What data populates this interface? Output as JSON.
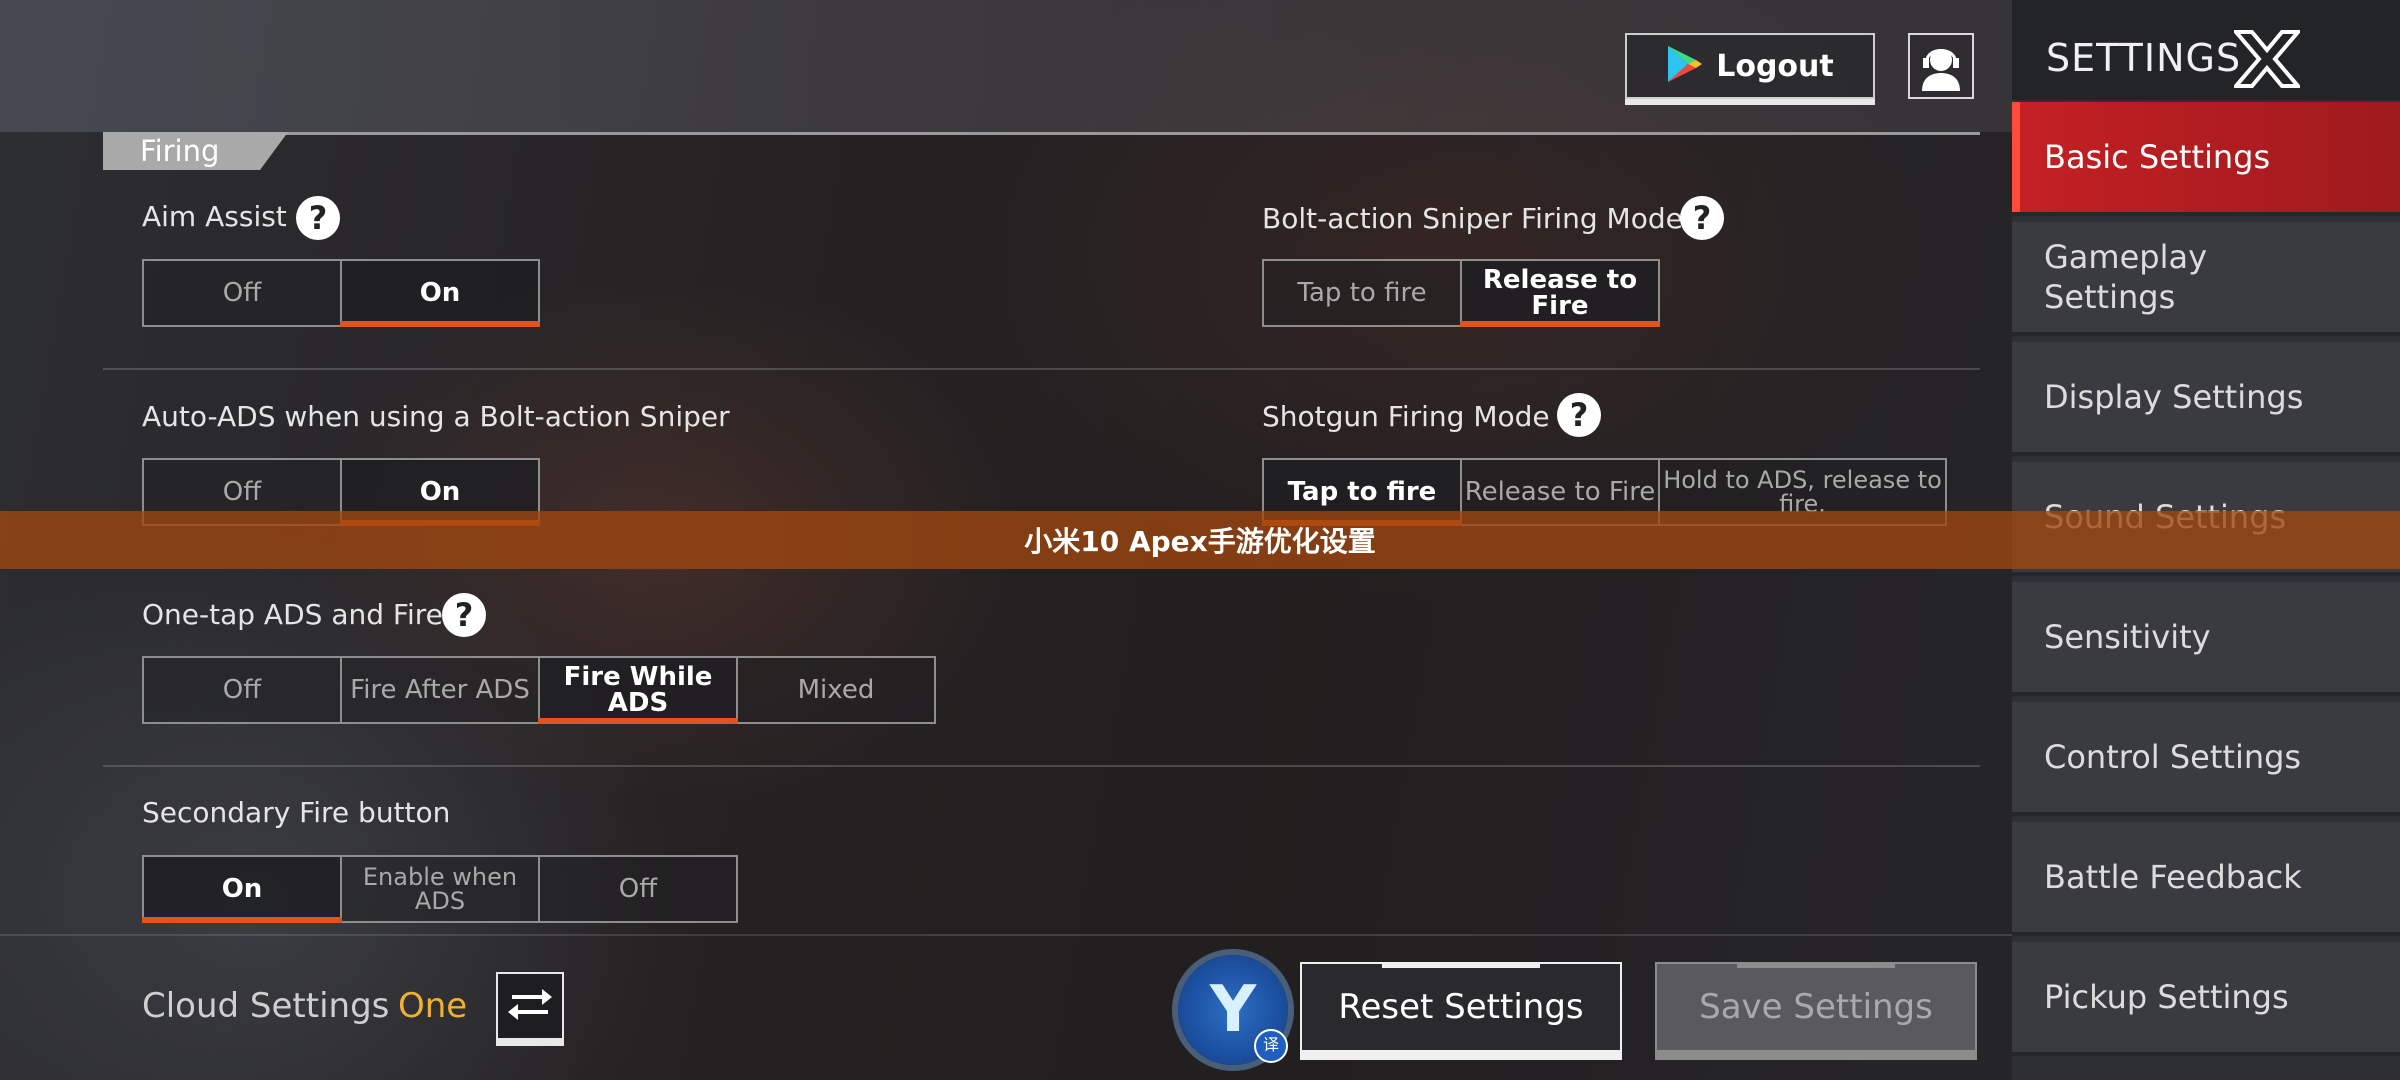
{
  "header": {
    "logout_label": "Logout",
    "support_icon": "headset-support-icon"
  },
  "section": {
    "title": "Firing"
  },
  "settings": {
    "aim_assist": {
      "label": "Aim Assist",
      "options": [
        "Off",
        "On"
      ],
      "selected": "On"
    },
    "bolt_action_mode": {
      "label": "Bolt-action Sniper Firing Mode",
      "options": [
        "Tap to fire",
        "Release to Fire"
      ],
      "selected": "Release to Fire"
    },
    "auto_ads": {
      "label": "Auto-ADS when using a Bolt-action Sniper",
      "options": [
        "Off",
        "On"
      ],
      "selected": "On"
    },
    "shotgun_mode": {
      "label": "Shotgun Firing Mode",
      "options": [
        "Tap to fire",
        "Release to Fire",
        "Hold to ADS, release to fire."
      ],
      "selected": "Tap to fire"
    },
    "one_tap_ads": {
      "label": "One-tap ADS and Fire",
      "options": [
        "Off",
        "Fire After ADS",
        "Fire While ADS",
        "Mixed"
      ],
      "selected": "Fire While ADS"
    },
    "secondary_fire": {
      "label": "Secondary Fire button",
      "options": [
        "On",
        "Enable when ADS",
        "Off"
      ],
      "selected": "On"
    }
  },
  "footer": {
    "cloud_label": "Cloud Settings",
    "cloud_value": "One",
    "translate_tag": "译",
    "reset_label": "Reset Settings",
    "save_label": "Save Settings"
  },
  "sidebar": {
    "title": "SETTINGS",
    "items": [
      {
        "label": "Basic Settings",
        "active": true
      },
      {
        "label": "Gameplay Settings",
        "active": false
      },
      {
        "label": "Display Settings",
        "active": false
      },
      {
        "label": "Sound Settings",
        "active": false
      },
      {
        "label": "Sensitivity",
        "active": false
      },
      {
        "label": "Control Settings",
        "active": false
      },
      {
        "label": "Battle Feedback",
        "active": false
      },
      {
        "label": "Pickup Settings",
        "active": false
      }
    ]
  },
  "banner": {
    "text": "小米10 Apex手游优化设置"
  },
  "colors": {
    "accent": "#e2541e",
    "active_tab": "#c42024",
    "cloud_value": "#f0b22a"
  }
}
